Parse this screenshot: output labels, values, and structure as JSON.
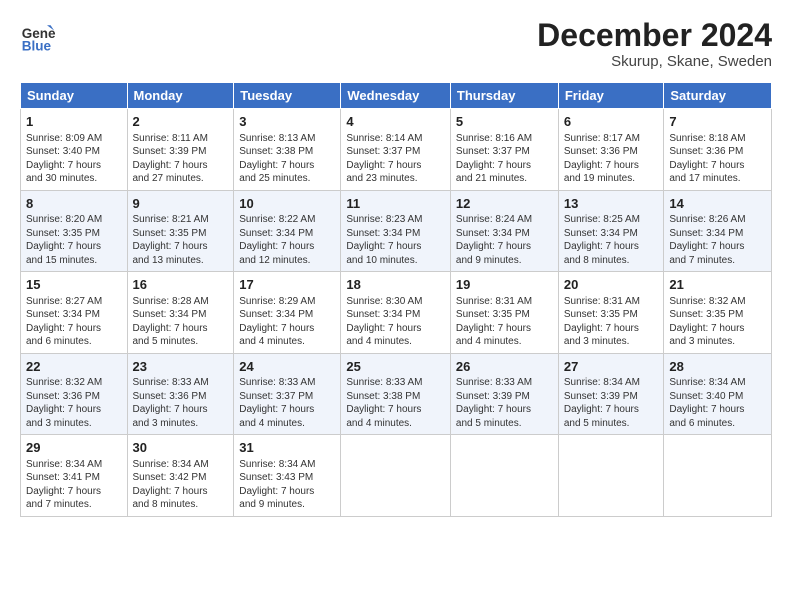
{
  "header": {
    "logo_line1": "General",
    "logo_line2": "Blue",
    "title": "December 2024",
    "subtitle": "Skurup, Skane, Sweden"
  },
  "columns": [
    "Sunday",
    "Monday",
    "Tuesday",
    "Wednesday",
    "Thursday",
    "Friday",
    "Saturday"
  ],
  "weeks": [
    [
      {
        "day": "1",
        "lines": [
          "Sunrise: 8:09 AM",
          "Sunset: 3:40 PM",
          "Daylight: 7 hours",
          "and 30 minutes."
        ]
      },
      {
        "day": "2",
        "lines": [
          "Sunrise: 8:11 AM",
          "Sunset: 3:39 PM",
          "Daylight: 7 hours",
          "and 27 minutes."
        ]
      },
      {
        "day": "3",
        "lines": [
          "Sunrise: 8:13 AM",
          "Sunset: 3:38 PM",
          "Daylight: 7 hours",
          "and 25 minutes."
        ]
      },
      {
        "day": "4",
        "lines": [
          "Sunrise: 8:14 AM",
          "Sunset: 3:37 PM",
          "Daylight: 7 hours",
          "and 23 minutes."
        ]
      },
      {
        "day": "5",
        "lines": [
          "Sunrise: 8:16 AM",
          "Sunset: 3:37 PM",
          "Daylight: 7 hours",
          "and 21 minutes."
        ]
      },
      {
        "day": "6",
        "lines": [
          "Sunrise: 8:17 AM",
          "Sunset: 3:36 PM",
          "Daylight: 7 hours",
          "and 19 minutes."
        ]
      },
      {
        "day": "7",
        "lines": [
          "Sunrise: 8:18 AM",
          "Sunset: 3:36 PM",
          "Daylight: 7 hours",
          "and 17 minutes."
        ]
      }
    ],
    [
      {
        "day": "8",
        "lines": [
          "Sunrise: 8:20 AM",
          "Sunset: 3:35 PM",
          "Daylight: 7 hours",
          "and 15 minutes."
        ]
      },
      {
        "day": "9",
        "lines": [
          "Sunrise: 8:21 AM",
          "Sunset: 3:35 PM",
          "Daylight: 7 hours",
          "and 13 minutes."
        ]
      },
      {
        "day": "10",
        "lines": [
          "Sunrise: 8:22 AM",
          "Sunset: 3:34 PM",
          "Daylight: 7 hours",
          "and 12 minutes."
        ]
      },
      {
        "day": "11",
        "lines": [
          "Sunrise: 8:23 AM",
          "Sunset: 3:34 PM",
          "Daylight: 7 hours",
          "and 10 minutes."
        ]
      },
      {
        "day": "12",
        "lines": [
          "Sunrise: 8:24 AM",
          "Sunset: 3:34 PM",
          "Daylight: 7 hours",
          "and 9 minutes."
        ]
      },
      {
        "day": "13",
        "lines": [
          "Sunrise: 8:25 AM",
          "Sunset: 3:34 PM",
          "Daylight: 7 hours",
          "and 8 minutes."
        ]
      },
      {
        "day": "14",
        "lines": [
          "Sunrise: 8:26 AM",
          "Sunset: 3:34 PM",
          "Daylight: 7 hours",
          "and 7 minutes."
        ]
      }
    ],
    [
      {
        "day": "15",
        "lines": [
          "Sunrise: 8:27 AM",
          "Sunset: 3:34 PM",
          "Daylight: 7 hours",
          "and 6 minutes."
        ]
      },
      {
        "day": "16",
        "lines": [
          "Sunrise: 8:28 AM",
          "Sunset: 3:34 PM",
          "Daylight: 7 hours",
          "and 5 minutes."
        ]
      },
      {
        "day": "17",
        "lines": [
          "Sunrise: 8:29 AM",
          "Sunset: 3:34 PM",
          "Daylight: 7 hours",
          "and 4 minutes."
        ]
      },
      {
        "day": "18",
        "lines": [
          "Sunrise: 8:30 AM",
          "Sunset: 3:34 PM",
          "Daylight: 7 hours",
          "and 4 minutes."
        ]
      },
      {
        "day": "19",
        "lines": [
          "Sunrise: 8:31 AM",
          "Sunset: 3:35 PM",
          "Daylight: 7 hours",
          "and 4 minutes."
        ]
      },
      {
        "day": "20",
        "lines": [
          "Sunrise: 8:31 AM",
          "Sunset: 3:35 PM",
          "Daylight: 7 hours",
          "and 3 minutes."
        ]
      },
      {
        "day": "21",
        "lines": [
          "Sunrise: 8:32 AM",
          "Sunset: 3:35 PM",
          "Daylight: 7 hours",
          "and 3 minutes."
        ]
      }
    ],
    [
      {
        "day": "22",
        "lines": [
          "Sunrise: 8:32 AM",
          "Sunset: 3:36 PM",
          "Daylight: 7 hours",
          "and 3 minutes."
        ]
      },
      {
        "day": "23",
        "lines": [
          "Sunrise: 8:33 AM",
          "Sunset: 3:36 PM",
          "Daylight: 7 hours",
          "and 3 minutes."
        ]
      },
      {
        "day": "24",
        "lines": [
          "Sunrise: 8:33 AM",
          "Sunset: 3:37 PM",
          "Daylight: 7 hours",
          "and 4 minutes."
        ]
      },
      {
        "day": "25",
        "lines": [
          "Sunrise: 8:33 AM",
          "Sunset: 3:38 PM",
          "Daylight: 7 hours",
          "and 4 minutes."
        ]
      },
      {
        "day": "26",
        "lines": [
          "Sunrise: 8:33 AM",
          "Sunset: 3:39 PM",
          "Daylight: 7 hours",
          "and 5 minutes."
        ]
      },
      {
        "day": "27",
        "lines": [
          "Sunrise: 8:34 AM",
          "Sunset: 3:39 PM",
          "Daylight: 7 hours",
          "and 5 minutes."
        ]
      },
      {
        "day": "28",
        "lines": [
          "Sunrise: 8:34 AM",
          "Sunset: 3:40 PM",
          "Daylight: 7 hours",
          "and 6 minutes."
        ]
      }
    ],
    [
      {
        "day": "29",
        "lines": [
          "Sunrise: 8:34 AM",
          "Sunset: 3:41 PM",
          "Daylight: 7 hours",
          "and 7 minutes."
        ]
      },
      {
        "day": "30",
        "lines": [
          "Sunrise: 8:34 AM",
          "Sunset: 3:42 PM",
          "Daylight: 7 hours",
          "and 8 minutes."
        ]
      },
      {
        "day": "31",
        "lines": [
          "Sunrise: 8:34 AM",
          "Sunset: 3:43 PM",
          "Daylight: 7 hours",
          "and 9 minutes."
        ]
      },
      null,
      null,
      null,
      null
    ]
  ]
}
